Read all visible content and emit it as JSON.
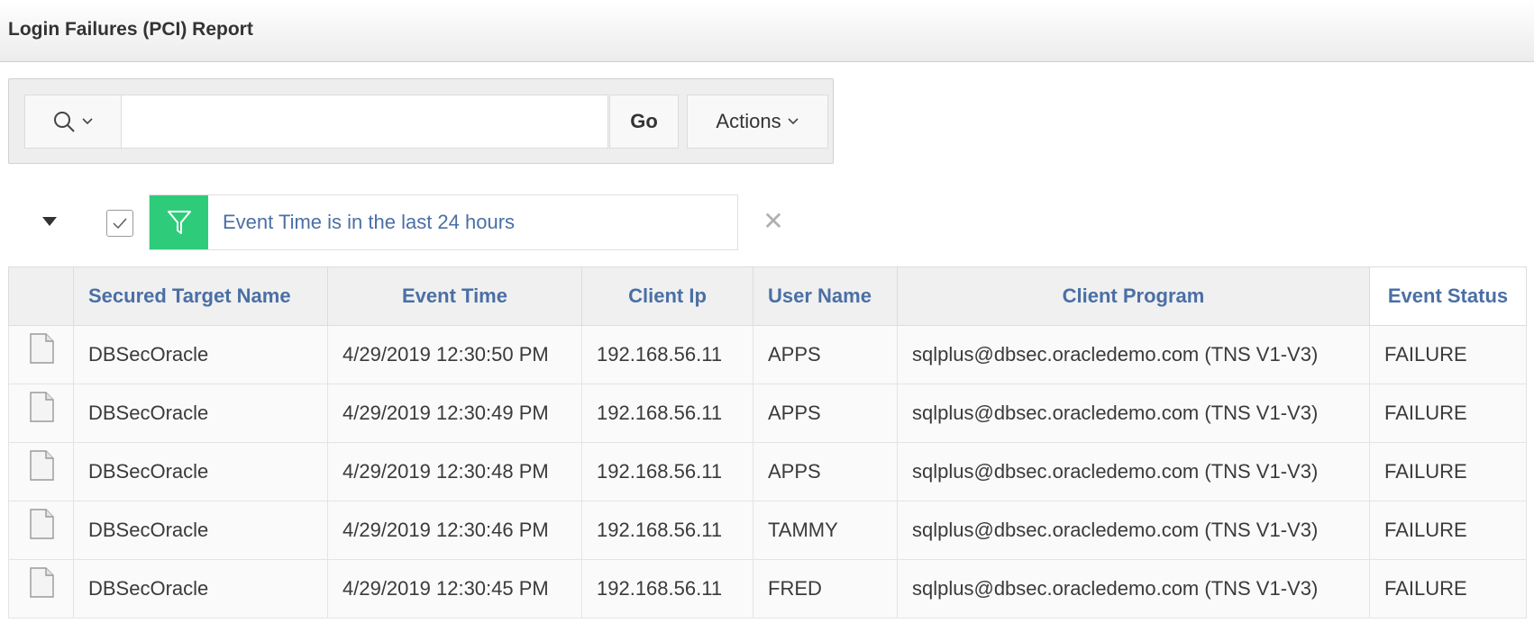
{
  "page": {
    "title": "Login Failures (PCI) Report"
  },
  "search": {
    "value": "",
    "placeholder": "",
    "go_label": "Go",
    "actions_label": "Actions"
  },
  "filter": {
    "text": "Event Time is in the last 24 hours",
    "enabled": true,
    "accent": "#2ecc7a"
  },
  "table": {
    "columns": [
      "Secured Target Name",
      "Event Time",
      "Client Ip",
      "User Name",
      "Client Program",
      "Event Status"
    ],
    "rows": [
      [
        "DBSecOracle",
        "4/29/2019 12:30:50 PM",
        "192.168.56.11",
        "APPS",
        "sqlplus@dbsec.oracledemo.com (TNS V1-V3)",
        "FAILURE"
      ],
      [
        "DBSecOracle",
        "4/29/2019 12:30:49 PM",
        "192.168.56.11",
        "APPS",
        "sqlplus@dbsec.oracledemo.com (TNS V1-V3)",
        "FAILURE"
      ],
      [
        "DBSecOracle",
        "4/29/2019 12:30:48 PM",
        "192.168.56.11",
        "APPS",
        "sqlplus@dbsec.oracledemo.com (TNS V1-V3)",
        "FAILURE"
      ],
      [
        "DBSecOracle",
        "4/29/2019 12:30:46 PM",
        "192.168.56.11",
        "TAMMY",
        "sqlplus@dbsec.oracledemo.com (TNS V1-V3)",
        "FAILURE"
      ],
      [
        "DBSecOracle",
        "4/29/2019 12:30:45 PM",
        "192.168.56.11",
        "FRED",
        "sqlplus@dbsec.oracledemo.com (TNS V1-V3)",
        "FAILURE"
      ]
    ]
  },
  "colors": {
    "header_text": "#4a6fa5",
    "filter_text": "#4a6fa5"
  }
}
